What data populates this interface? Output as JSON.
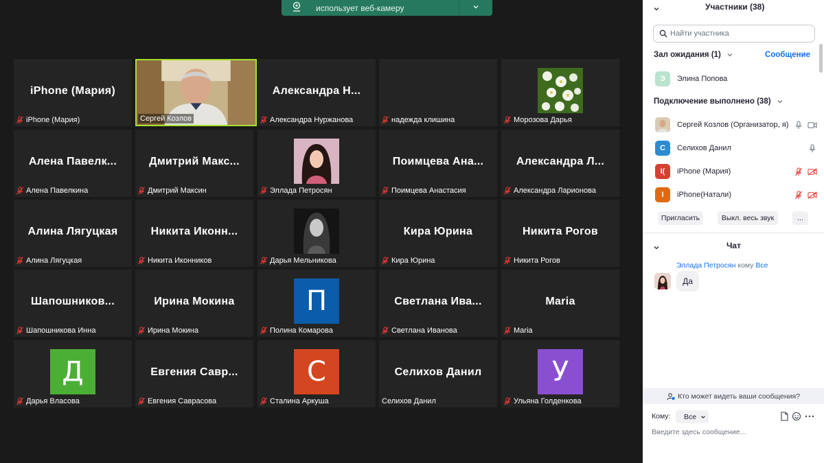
{
  "banner": {
    "text": "использует веб-камеру"
  },
  "tiles": [
    {
      "big": "iPhone (Мария)",
      "label": "iPhone (Мария)",
      "muted": true
    },
    {
      "big": "",
      "label": "Сергей Козлов",
      "muted": false,
      "video": true
    },
    {
      "big": "Александра Н...",
      "label": "Александра Нуржанова",
      "muted": true
    },
    {
      "big": "",
      "label": "надежда клишина",
      "muted": true
    },
    {
      "big": "",
      "label": "Морозова Дарья",
      "muted": true,
      "photo": "flowers"
    },
    {
      "big": "Алена Павелк...",
      "label": "Алена Павелкина",
      "muted": true
    },
    {
      "big": "Дмитрий Макс...",
      "label": "Дмитрий Максин",
      "muted": true
    },
    {
      "big": "",
      "label": "Эллада Петросян",
      "muted": true,
      "photo": "girl1"
    },
    {
      "big": "Поимцева Ана...",
      "label": "Поимцева Анастасия",
      "muted": true
    },
    {
      "big": "Александра Л...",
      "label": "Александра Ларионова",
      "muted": true
    },
    {
      "big": "Алина Лягуцкая",
      "label": "Алина Лягуцкая",
      "muted": true
    },
    {
      "big": "Никита Иконн...",
      "label": "Никита Иконников",
      "muted": true
    },
    {
      "big": "",
      "label": "Дарья Мельникова",
      "muted": true,
      "photo": "girl2"
    },
    {
      "big": "Кира Юрина",
      "label": "Кира Юрина",
      "muted": true
    },
    {
      "big": "Никита Рогов",
      "label": "Никита Рогов",
      "muted": true
    },
    {
      "big": "Шапошников...",
      "label": "Шапошникова Инна",
      "muted": true
    },
    {
      "big": "Ирина Мокина",
      "label": "Ирина Мокина",
      "muted": true
    },
    {
      "big": "",
      "label": "Полина Комарова",
      "muted": true,
      "letter": "П",
      "color": "#0b5cab"
    },
    {
      "big": "Светлана Ива...",
      "label": "Светлана Иванова",
      "muted": true
    },
    {
      "big": "Maria",
      "label": "Maria",
      "muted": true
    },
    {
      "big": "",
      "label": "Дарья Власова",
      "muted": true,
      "letter": "Д",
      "color": "#4caf35"
    },
    {
      "big": "Евгения Савр...",
      "label": "Евгения Саврасова",
      "muted": true
    },
    {
      "big": "",
      "label": "Сталина Аркуша",
      "muted": true,
      "letter": "С",
      "color": "#d4461f"
    },
    {
      "big": "Селихов Данил",
      "label": "Селихов Данил",
      "muted": false
    },
    {
      "big": "",
      "label": "Ульяна Голденкова",
      "muted": true,
      "letter": "У",
      "color": "#8a4fd1"
    }
  ],
  "sidebar": {
    "participants_title": "Участники (38)",
    "search_placeholder": "Найти участника",
    "waiting_room": "Зал ожидания (1)",
    "message_link": "Сообщение",
    "waiting": [
      {
        "initial": "Э",
        "name": "Элина Попова",
        "color": "#b9e2cf"
      }
    ],
    "connected_title": "Подключение выполнено (38)",
    "participants": [
      {
        "name": "Сергей Козлов (Организатор, я)",
        "initial": "",
        "color": "#d8d8d8",
        "photo": true,
        "mic": "on",
        "cam": "on"
      },
      {
        "name": "Селихов Данил",
        "initial": "С",
        "color": "#2d8cd1",
        "mic": "on",
        "cam": ""
      },
      {
        "name": "iPhone (Мария)",
        "initial": "I(",
        "color": "#d64030",
        "mic": "off",
        "cam": "off"
      },
      {
        "name": "iPhone(Натали)",
        "initial": "I",
        "color": "#e06a14",
        "mic": "off",
        "cam": "off"
      }
    ],
    "invite_button": "Пригласить",
    "mute_all_button": "Выкл. весь звук",
    "more_button": "...",
    "chat_title": "Чат",
    "chat_sender": "Эллада Петросян",
    "chat_to": "кому",
    "chat_all": "Все",
    "chat_message": "Да",
    "who_can_see": "Кто может видеть ваши сообщения?",
    "to_label": "Кому:",
    "to_value": "Все",
    "message_placeholder": "Введите здесь сообщение..."
  }
}
